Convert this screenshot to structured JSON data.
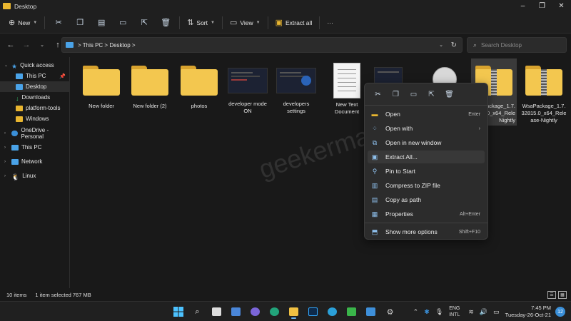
{
  "window": {
    "title": "Desktop",
    "controls": [
      "–",
      "❐",
      "✕"
    ]
  },
  "toolbar": {
    "new_label": "New",
    "sort_label": "Sort",
    "view_label": "View",
    "extract_label": "Extract all",
    "more_label": "···"
  },
  "address": {
    "crumbs": "> This PC > Desktop >",
    "search_placeholder": "Search Desktop"
  },
  "sidebar": {
    "items": [
      {
        "label": "Quick access",
        "color": "#4aa3e8"
      },
      {
        "label": "This PC",
        "color": "#4aa3e8"
      },
      {
        "label": "Desktop",
        "color": "#4aa3e8"
      },
      {
        "label": "Downloads",
        "color": "#34c06a"
      },
      {
        "label": "platform-tools",
        "color": "#e9b630"
      },
      {
        "label": "Windows",
        "color": "#e9b630"
      },
      {
        "label": "OneDrive - Personal",
        "color": "#3a8fd8"
      },
      {
        "label": "This PC",
        "color": "#4aa3e8"
      },
      {
        "label": "Network",
        "color": "#4aa3e8"
      },
      {
        "label": "Linux",
        "color": "#dcdcdc"
      }
    ]
  },
  "files": [
    {
      "label": "New folder"
    },
    {
      "label": "New folder (2)"
    },
    {
      "label": "photos"
    },
    {
      "label": "developer mode ON"
    },
    {
      "label": "developers settings"
    },
    {
      "label": "New Text Document"
    },
    {
      "label": "ackage_1.7.\n0_x64_Rele\nNightly"
    },
    {
      "label": "WsaPackage_1.7.\n32815.0_x64_Rele\nase-Nightly"
    }
  ],
  "watermark": "geekermag.com",
  "context_menu": {
    "items": [
      {
        "label": "Open",
        "shortcut": "Enter"
      },
      {
        "label": "Open with",
        "shortcut": "›"
      },
      {
        "label": "Open in new window",
        "shortcut": ""
      },
      {
        "label": "Extract All...",
        "shortcut": ""
      },
      {
        "label": "Pin to Start",
        "shortcut": ""
      },
      {
        "label": "Compress to ZIP file",
        "shortcut": ""
      },
      {
        "label": "Copy as path",
        "shortcut": ""
      },
      {
        "label": "Properties",
        "shortcut": "Alt+Enter"
      },
      {
        "label": "Show more options",
        "shortcut": "Shift+F10"
      }
    ]
  },
  "status": {
    "items_count": "10 items",
    "selection": "1 item selected  767 MB"
  },
  "taskbar": {
    "lang_top": "ENG",
    "lang_bottom": "INTL",
    "time": "7:45 PM",
    "date": "Tuesday-26-Oct-21",
    "notifications": "12"
  }
}
